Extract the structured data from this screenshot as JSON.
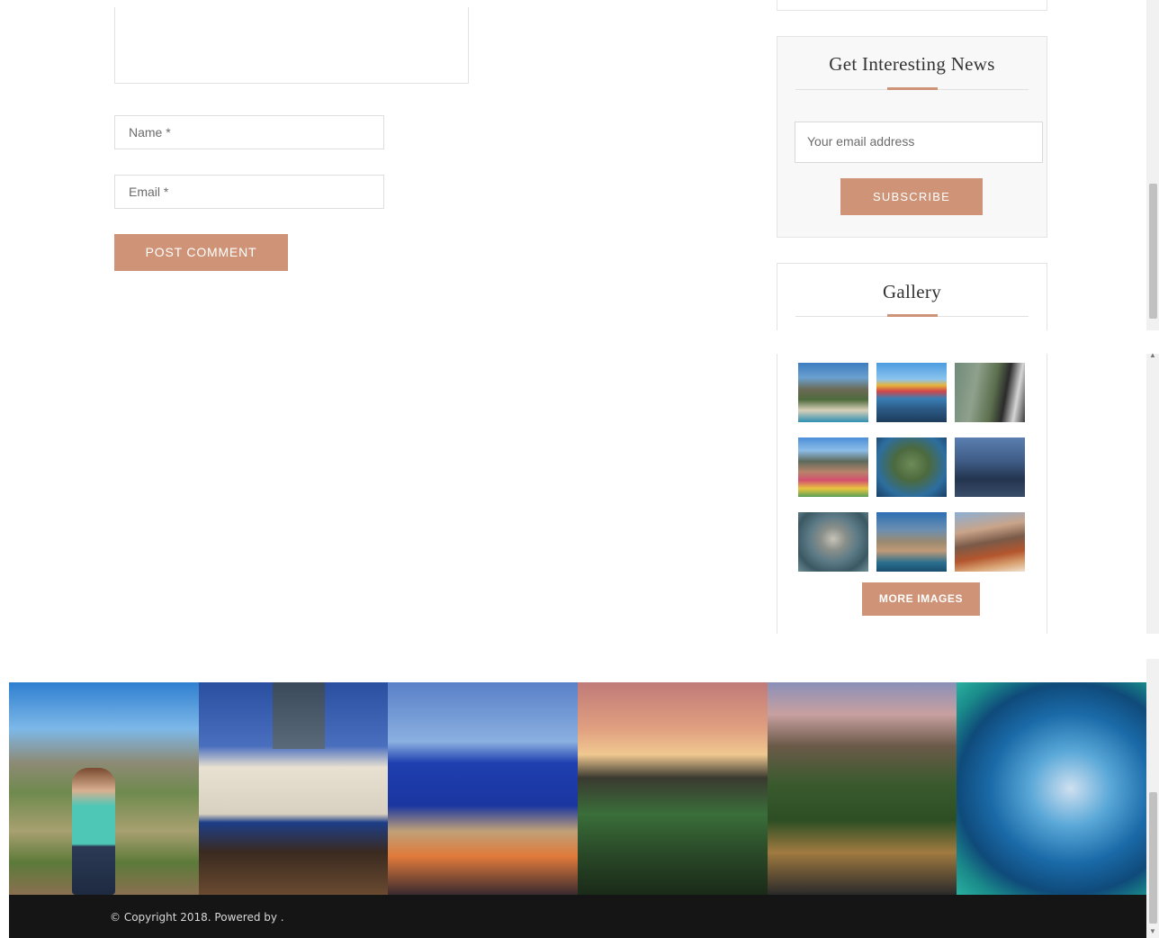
{
  "comment_form": {
    "name_placeholder": "Name *",
    "email_placeholder": "Email *",
    "post_label": "POST COMMENT"
  },
  "newsletter": {
    "title": "Get Interesting News",
    "email_placeholder": "Your email address",
    "subscribe_label": "SUBSCRIBE"
  },
  "gallery": {
    "title": "Gallery",
    "more_label": "MORE IMAGES",
    "thumbs": [
      "table-mountain-beach-photo",
      "colorful-beach-huts-photo",
      "man-on-mountain-photo",
      "bo-kaap-houses-photo",
      "aerial-peninsula-photo",
      "glass-tower-photo",
      "rooftop-pool-photo",
      "aerial-city-photo",
      "table-mountain-road-photo"
    ]
  },
  "footer_strip": [
    "woman-on-mountain-photo",
    "mojo-building-photo",
    "convention-centre-photo",
    "sunset-picnic-photo",
    "table-mountain-road-photo",
    "ocean-wave-photo"
  ],
  "footer": {
    "copyright": "© Copyright 2018. Powered by ."
  },
  "colors": {
    "accent": "#cf9478",
    "footer_bg": "#151515",
    "border": "#e3e3e3"
  }
}
